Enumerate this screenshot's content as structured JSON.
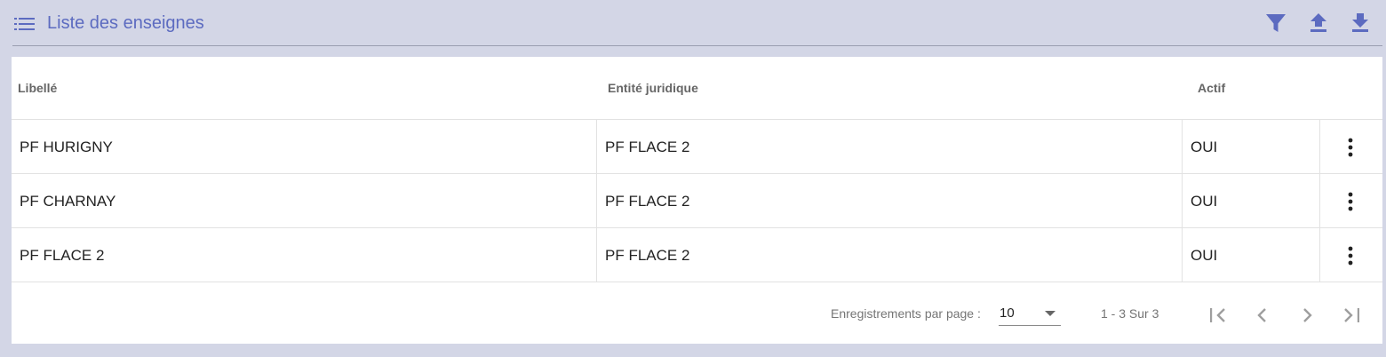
{
  "header": {
    "title": "Liste des enseignes",
    "icons": [
      "list-icon",
      "filter-icon",
      "upload-icon",
      "download-icon"
    ]
  },
  "table": {
    "columns": [
      "Libellé",
      "Entité juridique",
      "Actif"
    ],
    "rows": [
      {
        "libelle": "PF HURIGNY",
        "entite": "PF FLACE 2",
        "actif": "OUI"
      },
      {
        "libelle": "PF CHARNAY",
        "entite": "PF FLACE 2",
        "actif": "OUI"
      },
      {
        "libelle": "PF FLACE 2",
        "entite": "PF FLACE 2",
        "actif": "OUI"
      }
    ]
  },
  "paginator": {
    "label": "Enregistrements par page :",
    "page_size": "10",
    "range": "1 - 3 Sur 3"
  },
  "colors": {
    "accent": "#5c6bc0",
    "background": "#d3d6e6"
  }
}
